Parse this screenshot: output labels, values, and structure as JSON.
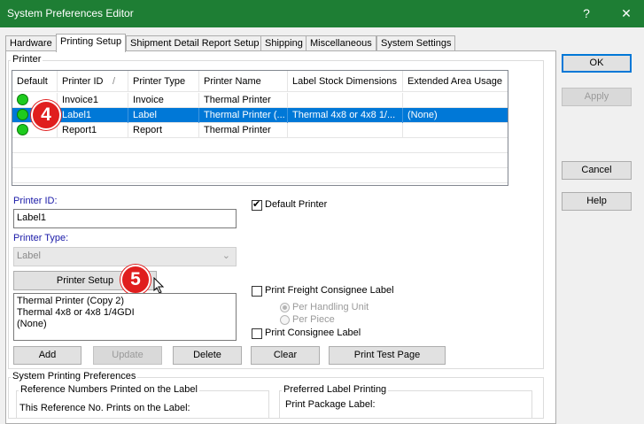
{
  "window": {
    "title": "System Preferences Editor",
    "help_glyph": "?",
    "close_glyph": "✕"
  },
  "tabs": [
    "Hardware",
    "Printing Setup",
    "Shipment Detail Report Setup",
    "Shipping",
    "Miscellaneous",
    "System Settings"
  ],
  "printer_group": {
    "label": "Printer"
  },
  "grid": {
    "columns": [
      "Default",
      "Printer ID",
      "Printer Type",
      "Printer Name",
      "Label Stock Dimensions",
      "Extended Area Usage"
    ],
    "sort_glyph": "/",
    "rows": [
      {
        "default": true,
        "id": "Invoice1",
        "type": "Invoice",
        "name": "Thermal Printer",
        "stock": "",
        "extended": "",
        "selected": false
      },
      {
        "default": true,
        "id": "Label1",
        "type": "Label",
        "name": "Thermal Printer (...",
        "stock": "Thermal 4x8 or 4x8 1/...",
        "extended": "(None)",
        "selected": true
      },
      {
        "default": true,
        "id": "Report1",
        "type": "Report",
        "name": "Thermal Printer",
        "stock": "",
        "extended": "",
        "selected": false
      }
    ]
  },
  "form": {
    "printer_id_label": "Printer ID:",
    "printer_id_value": "Label1",
    "printer_type_label": "Printer Type:",
    "printer_type_value": "Label",
    "default_printer_label": "Default Printer",
    "default_printer_checked": true,
    "printer_setup_button": "Printer Setup",
    "printer_info": [
      "Thermal Printer (Copy 2)",
      "Thermal 4x8 or 4x8 1/4GDI",
      "(None)"
    ],
    "freight_label": "Print Freight Consignee Label",
    "per_handling_unit": "Per Handling Unit",
    "per_piece": "Per Piece",
    "consignee_label": "Print Consignee Label"
  },
  "buttons": {
    "add": "Add",
    "update": "Update",
    "delete": "Delete",
    "clear": "Clear",
    "test": "Print Test Page",
    "ok": "OK",
    "apply": "Apply",
    "cancel": "Cancel",
    "help": "Help"
  },
  "system_printing": {
    "label": "System Printing Preferences",
    "reference_label": "Reference Numbers Printed on the Label",
    "reference_text": "This Reference No. Prints on the Label:",
    "preferred_label": "Preferred Label Printing",
    "print_package_label": "Print Package Label:"
  },
  "annotations": {
    "step4": "4",
    "step5": "5"
  },
  "colors": {
    "titlebar": "#1e7e34",
    "selection": "#0078d7",
    "badge": "#e01e1e",
    "status_dot": "#1ecb1e"
  }
}
